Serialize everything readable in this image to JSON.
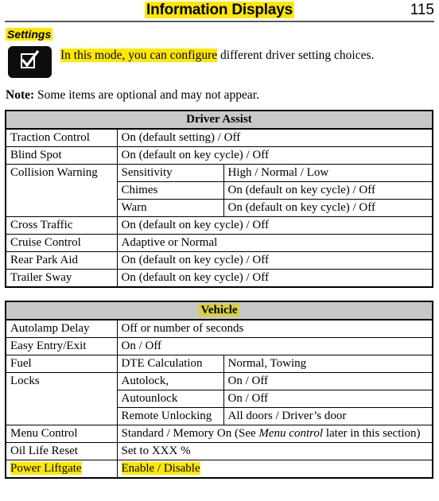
{
  "header": {
    "title": "Information Displays",
    "page_number": "115",
    "title_highlight_color": "#ffe800"
  },
  "settings": {
    "heading": "Settings",
    "icon_name": "checkbox-checked-icon",
    "intro_highlighted": "In this mode, you can configure",
    "intro_rest": " different driver setting choices.",
    "note_label": "Note:",
    "note_text": " Some items are optional and may not appear."
  },
  "tables": [
    {
      "title": "Driver Assist",
      "title_highlighted": false,
      "rows": [
        {
          "cells": [
            {
              "text": "Traction Control",
              "colspan": 1
            },
            {
              "text": "On (default setting) / Off",
              "colspan": 2
            }
          ]
        },
        {
          "cells": [
            {
              "text": "Blind Spot",
              "colspan": 1
            },
            {
              "text": "On (default on key cycle) / Off",
              "colspan": 2
            }
          ]
        },
        {
          "cells": [
            {
              "text": "Collision Warning",
              "colspan": 1,
              "rowmerge": "top"
            },
            {
              "text": "Sensitivity",
              "colspan": 1
            },
            {
              "text": "High / Normal / Low",
              "colspan": 1
            }
          ]
        },
        {
          "cells": [
            {
              "text": "",
              "colspan": 1,
              "rowmerge": "mid"
            },
            {
              "text": "Chimes",
              "colspan": 1
            },
            {
              "text": "On (default on key cycle) / Off",
              "colspan": 1
            }
          ]
        },
        {
          "cells": [
            {
              "text": "",
              "colspan": 1,
              "rowmerge": "bot"
            },
            {
              "text": "Warn",
              "colspan": 1
            },
            {
              "text": "On (default on key cycle) / Off",
              "colspan": 1
            }
          ]
        },
        {
          "cells": [
            {
              "text": "Cross Traffic",
              "colspan": 1
            },
            {
              "text": "On (default on key cycle) / Off",
              "colspan": 2
            }
          ]
        },
        {
          "cells": [
            {
              "text": "Cruise Control",
              "colspan": 1
            },
            {
              "text": "Adaptive or Normal",
              "colspan": 2
            }
          ]
        },
        {
          "cells": [
            {
              "text": "Rear Park Aid",
              "colspan": 1
            },
            {
              "text": "On (default on key cycle) / Off",
              "colspan": 2
            }
          ]
        },
        {
          "cells": [
            {
              "text": "Trailer Sway",
              "colspan": 1
            },
            {
              "text": "On (default on key cycle) / Off",
              "colspan": 2
            }
          ]
        }
      ]
    },
    {
      "title": "Vehicle",
      "title_highlighted": true,
      "rows": [
        {
          "cells": [
            {
              "text": "Autolamp Delay",
              "colspan": 1
            },
            {
              "text": "Off or number of seconds",
              "colspan": 2
            }
          ]
        },
        {
          "cells": [
            {
              "text": "Easy Entry/Exit",
              "colspan": 1
            },
            {
              "text": "On / Off",
              "colspan": 2
            }
          ]
        },
        {
          "cells": [
            {
              "text": "Fuel",
              "colspan": 1
            },
            {
              "text": "DTE Calculation",
              "colspan": 1
            },
            {
              "text": "Normal, Towing",
              "colspan": 1
            }
          ]
        },
        {
          "cells": [
            {
              "text": "Locks",
              "colspan": 1,
              "rowmerge": "top"
            },
            {
              "text": "Autolock,",
              "colspan": 1
            },
            {
              "text": "On / Off",
              "colspan": 1
            }
          ]
        },
        {
          "cells": [
            {
              "text": "",
              "colspan": 1,
              "rowmerge": "mid"
            },
            {
              "text": "Autounlock",
              "colspan": 1
            },
            {
              "text": "On / Off",
              "colspan": 1
            }
          ]
        },
        {
          "cells": [
            {
              "text": "",
              "colspan": 1,
              "rowmerge": "bot"
            },
            {
              "text": "Remote Unlocking",
              "colspan": 1
            },
            {
              "text": "All doors / Driver’s door",
              "colspan": 1
            }
          ]
        },
        {
          "cells": [
            {
              "text": "Menu Control",
              "colspan": 1
            },
            {
              "text": "Standard / Memory On (See Menu control later in this section)",
              "colspan": 2,
              "italic_part": "Menu control"
            }
          ]
        },
        {
          "cells": [
            {
              "text": "Oil Life Reset",
              "colspan": 1
            },
            {
              "text": "Set to XXX %",
              "colspan": 2
            }
          ]
        },
        {
          "cells": [
            {
              "text": "Power Liftgate",
              "colspan": 1,
              "highlight": true
            },
            {
              "text": "Enable / Disable",
              "colspan": 2,
              "highlight": true
            }
          ]
        }
      ]
    }
  ]
}
